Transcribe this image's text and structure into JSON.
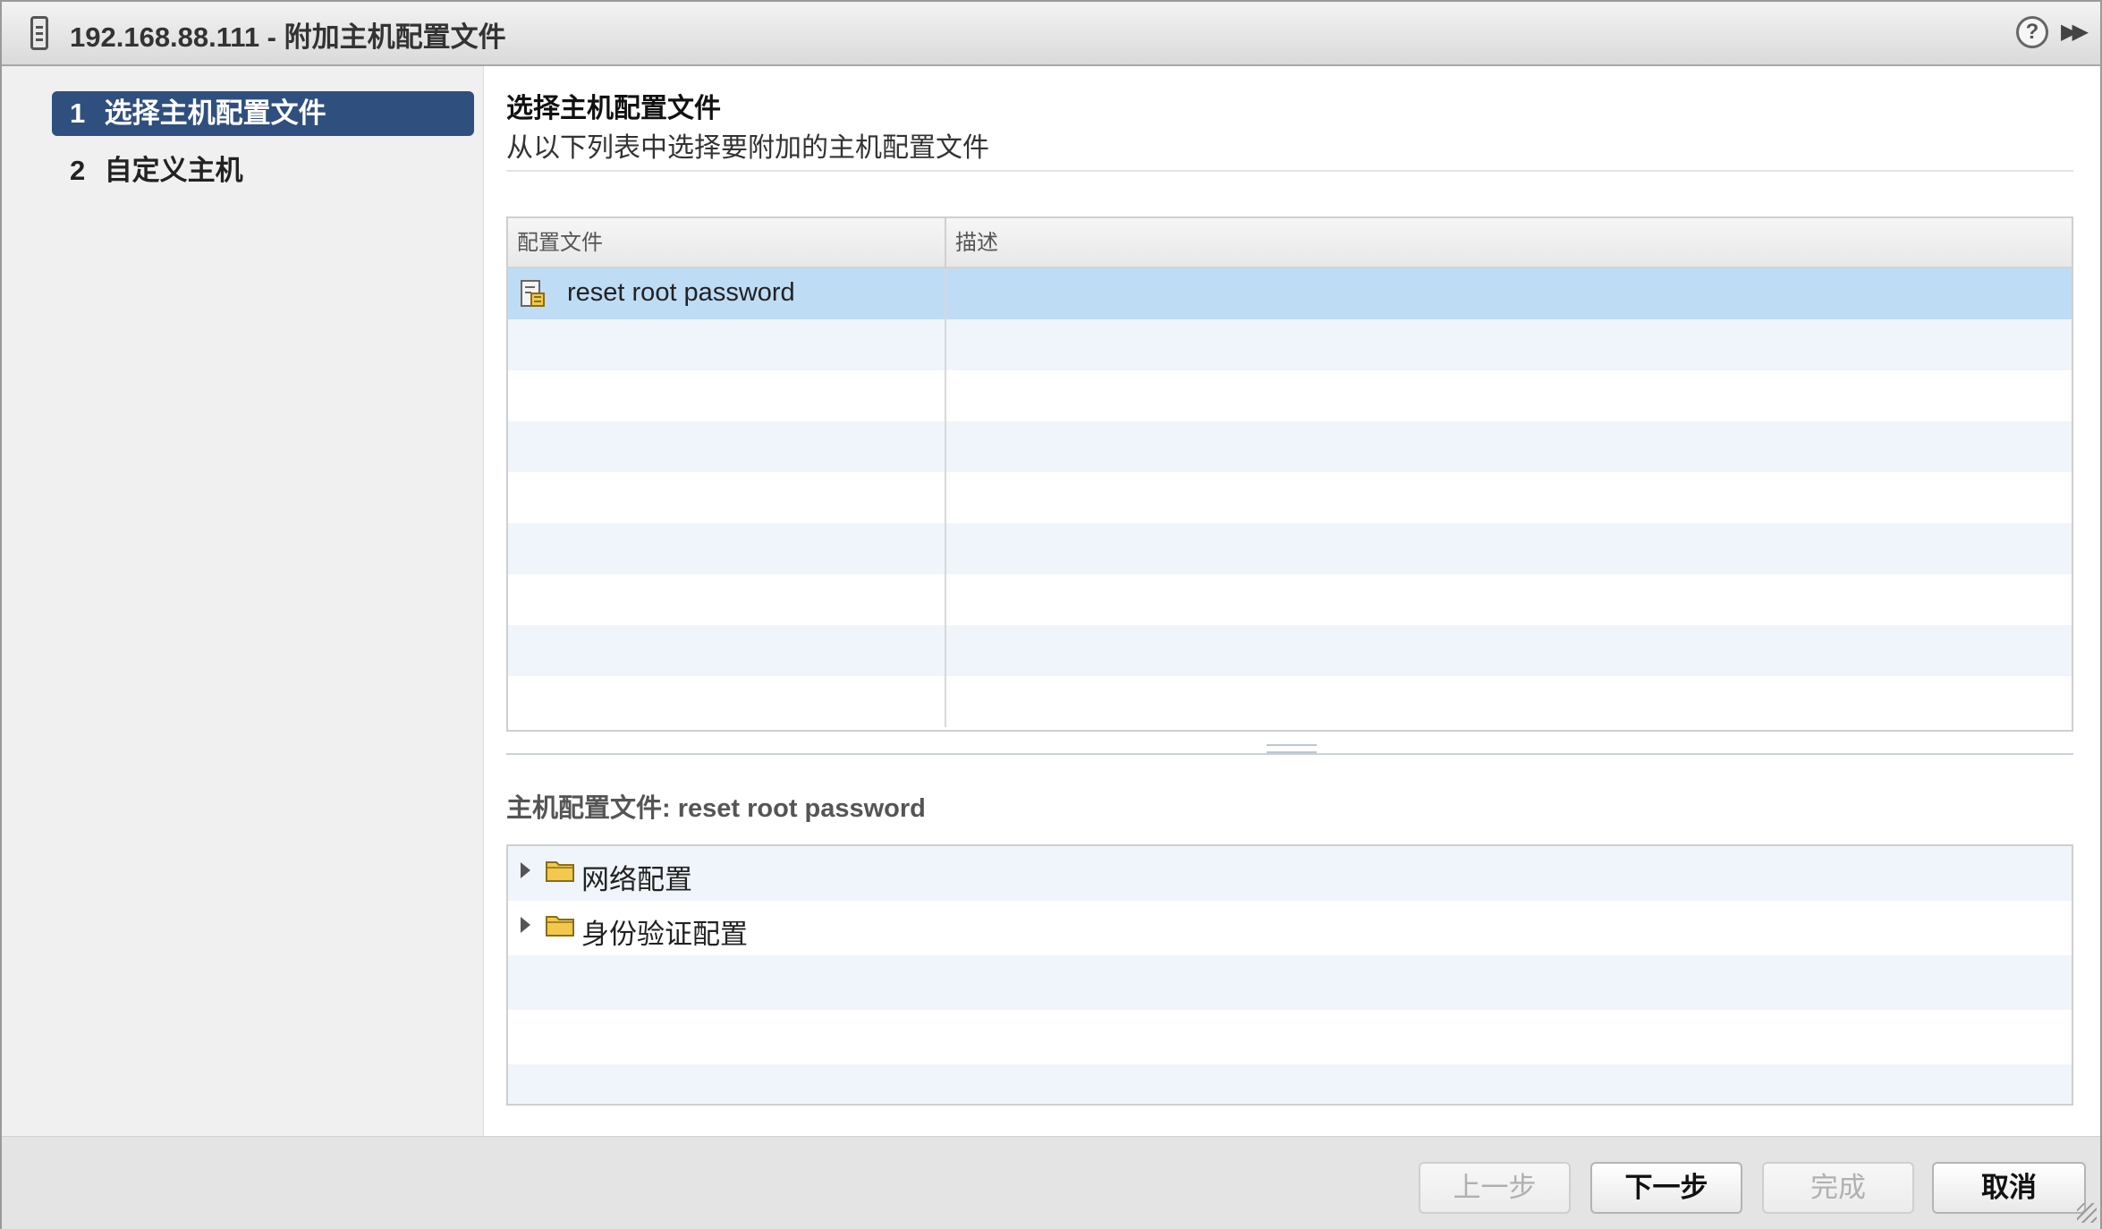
{
  "window": {
    "title": "192.168.88.111 - 附加主机配置文件",
    "title_icon": "host-icon",
    "help_icon": "help-icon",
    "expand_icon": "expand-panel-icon"
  },
  "nav": {
    "steps": [
      {
        "number": "1",
        "label": "选择主机配置文件",
        "active": true
      },
      {
        "number": "2",
        "label": "自定义主机",
        "active": false
      }
    ]
  },
  "main": {
    "title": "选择主机配置文件",
    "subtitle": "从以下列表中选择要附加的主机配置文件",
    "table": {
      "columns": [
        "配置文件",
        "描述"
      ],
      "rows": [
        {
          "name": "reset root password",
          "description": "",
          "selected": true,
          "icon": "host-profile-icon"
        }
      ]
    },
    "detail": {
      "title": "主机配置文件: reset root password",
      "tree": [
        {
          "label": "网络配置",
          "icon": "folder-icon",
          "expanded": false
        },
        {
          "label": "身份验证配置",
          "icon": "folder-icon",
          "expanded": false
        }
      ]
    }
  },
  "footer": {
    "back_label": "上一步",
    "next_label": "下一步",
    "finish_label": "完成",
    "cancel_label": "取消"
  },
  "colors": {
    "active_step": "#2f4f7e",
    "selected_row": "#bfdcf5",
    "stripe_row": "#eff5fb",
    "folder": "#f2c94c"
  }
}
